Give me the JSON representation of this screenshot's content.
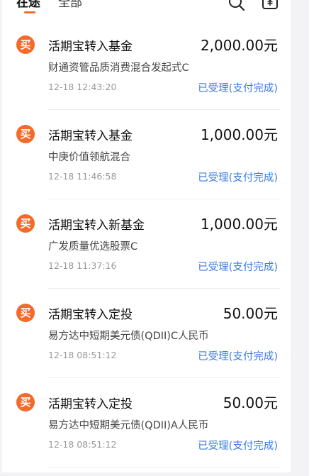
{
  "tabs": [
    "在途",
    "全部"
  ],
  "icons": {
    "search": "search-icon",
    "wallet": "yuan-wallet-icon",
    "buy": "buy-badge-icon"
  },
  "colors": {
    "accent": "#f36a2b",
    "status": "#3d7be0"
  },
  "records": [
    {
      "badge": "买",
      "title": "活期宝转入基金",
      "amount": "2,000.00元",
      "fund": "财通资管品质消费混合发起式C",
      "time": "12-18 12:43:20",
      "status": "已受理(支付完成)"
    },
    {
      "badge": "买",
      "title": "活期宝转入基金",
      "amount": "1,000.00元",
      "fund": "中庚价值领航混合",
      "time": "12-18 11:46:58",
      "status": "已受理(支付完成)"
    },
    {
      "badge": "买",
      "title": "活期宝转入新基金",
      "amount": "1,000.00元",
      "fund": "广发质量优选股票C",
      "time": "12-18 11:37:16",
      "status": "已受理(支付完成)"
    },
    {
      "badge": "买",
      "title": "活期宝转入定投",
      "amount": "50.00元",
      "fund": "易方达中短期美元债(QDII)C人民币",
      "time": "12-18 08:51:12",
      "status": "已受理(支付完成)"
    },
    {
      "badge": "买",
      "title": "活期宝转入定投",
      "amount": "50.00元",
      "fund": "易方达中短期美元债(QDII)A人民币",
      "time": "12-18 08:51:12",
      "status": "已受理(支付完成)"
    }
  ]
}
